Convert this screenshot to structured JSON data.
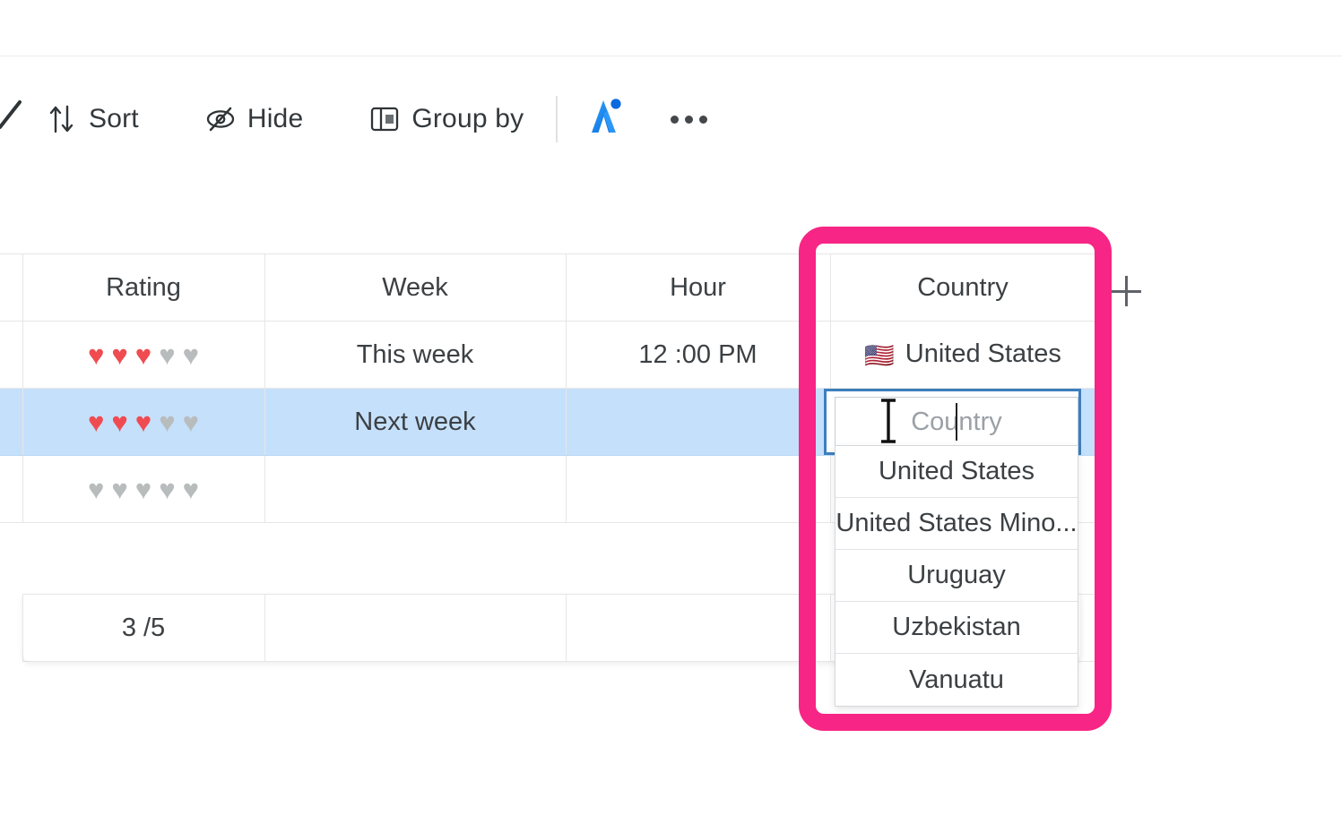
{
  "toolbar": {
    "items": [
      {
        "label": "Sort",
        "icon": "sort-icon"
      },
      {
        "label": "Hide",
        "icon": "hide-eye-icon"
      },
      {
        "label": "Group by",
        "icon": "group-by-icon"
      }
    ],
    "ai_button": {
      "icon": "ai-sparkle-icon"
    },
    "more_button": {
      "icon": "more-horizontal-icon"
    }
  },
  "grid": {
    "columns": [
      {
        "key": "rating",
        "header": "Rating"
      },
      {
        "key": "week",
        "header": "Week"
      },
      {
        "key": "hour",
        "header": "Hour"
      },
      {
        "key": "country",
        "header": "Country"
      }
    ],
    "add_column_label": "+",
    "rows": [
      {
        "rating_filled": 3,
        "rating_total": 5,
        "week": "This week",
        "hour": "12 :00 PM",
        "country": "United States",
        "country_flag": "🇺🇸",
        "selected": false
      },
      {
        "rating_filled": 3,
        "rating_total": 5,
        "week": "Next week",
        "hour": "",
        "country": "",
        "country_flag": "",
        "selected": true
      },
      {
        "rating_filled": 0,
        "rating_total": 5,
        "week": "",
        "hour": "",
        "country": "",
        "country_flag": "",
        "selected": false
      }
    ],
    "summary": {
      "rating": "3 /5",
      "week": "",
      "hour": "",
      "country": ""
    }
  },
  "country_editor": {
    "placeholder": "Country",
    "value": "",
    "options": [
      "United States",
      "United States Mino...",
      "Uruguay",
      "Uzbekistan",
      "Vanuatu"
    ]
  },
  "colors": {
    "annotation_pink": "#f72585",
    "row_highlight_blue": "#c5e0fb",
    "cell_select_blue": "#3c7fbe",
    "heart_filled": "#ef4b51",
    "heart_empty": "#b9bcbd",
    "ai_blue": "#1a8cff"
  }
}
